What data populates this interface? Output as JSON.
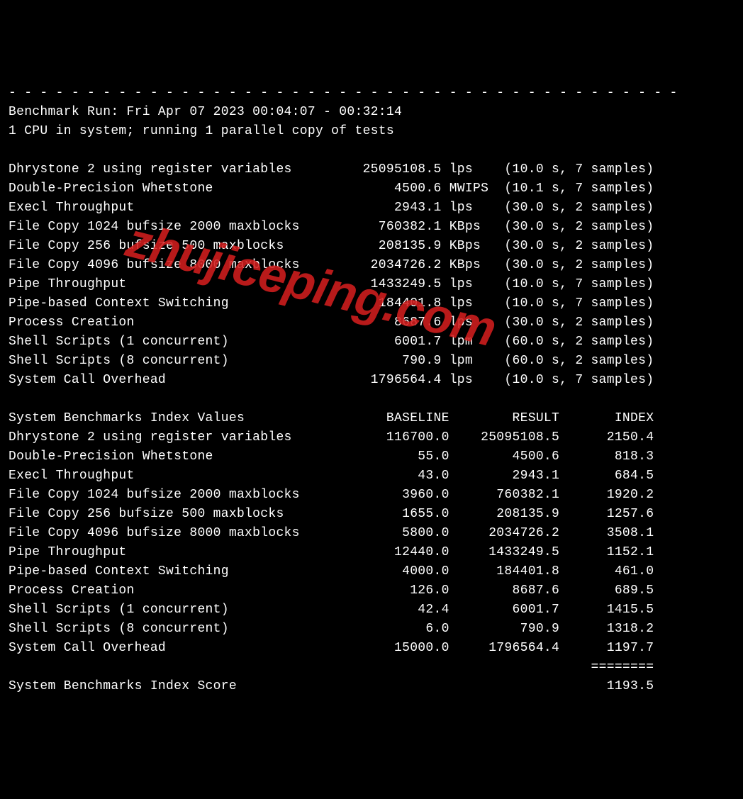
{
  "divider": "- - - - - - - - - - - - - - - - - - - - - - - - - - - - - - - - - - - - - - - - - - -",
  "header": {
    "run_line": "Benchmark Run: Fri Apr 07 2023 00:04:07 - 00:32:14",
    "cpu_line": "1 CPU in system; running 1 parallel copy of tests"
  },
  "tests": [
    {
      "name": "Dhrystone 2 using register variables",
      "value": "25095108.5",
      "unit": "lps",
      "dur": "10.0",
      "samples": "7"
    },
    {
      "name": "Double-Precision Whetstone",
      "value": "4500.6",
      "unit": "MWIPS",
      "dur": "10.1",
      "samples": "7"
    },
    {
      "name": "Execl Throughput",
      "value": "2943.1",
      "unit": "lps",
      "dur": "30.0",
      "samples": "2"
    },
    {
      "name": "File Copy 1024 bufsize 2000 maxblocks",
      "value": "760382.1",
      "unit": "KBps",
      "dur": "30.0",
      "samples": "2"
    },
    {
      "name": "File Copy 256 bufsize 500 maxblocks",
      "value": "208135.9",
      "unit": "KBps",
      "dur": "30.0",
      "samples": "2"
    },
    {
      "name": "File Copy 4096 bufsize 8000 maxblocks",
      "value": "2034726.2",
      "unit": "KBps",
      "dur": "30.0",
      "samples": "2"
    },
    {
      "name": "Pipe Throughput",
      "value": "1433249.5",
      "unit": "lps",
      "dur": "10.0",
      "samples": "7"
    },
    {
      "name": "Pipe-based Context Switching",
      "value": "184401.8",
      "unit": "lps",
      "dur": "10.0",
      "samples": "7"
    },
    {
      "name": "Process Creation",
      "value": "8687.6",
      "unit": "lps",
      "dur": "30.0",
      "samples": "2"
    },
    {
      "name": "Shell Scripts (1 concurrent)",
      "value": "6001.7",
      "unit": "lpm",
      "dur": "60.0",
      "samples": "2"
    },
    {
      "name": "Shell Scripts (8 concurrent)",
      "value": "790.9",
      "unit": "lpm",
      "dur": "60.0",
      "samples": "2"
    },
    {
      "name": "System Call Overhead",
      "value": "1796564.4",
      "unit": "lps",
      "dur": "10.0",
      "samples": "7"
    }
  ],
  "index_header": {
    "title": "System Benchmarks Index Values",
    "c1": "BASELINE",
    "c2": "RESULT",
    "c3": "INDEX"
  },
  "index": [
    {
      "name": "Dhrystone 2 using register variables",
      "baseline": "116700.0",
      "result": "25095108.5",
      "index": "2150.4"
    },
    {
      "name": "Double-Precision Whetstone",
      "baseline": "55.0",
      "result": "4500.6",
      "index": "818.3"
    },
    {
      "name": "Execl Throughput",
      "baseline": "43.0",
      "result": "2943.1",
      "index": "684.5"
    },
    {
      "name": "File Copy 1024 bufsize 2000 maxblocks",
      "baseline": "3960.0",
      "result": "760382.1",
      "index": "1920.2"
    },
    {
      "name": "File Copy 256 bufsize 500 maxblocks",
      "baseline": "1655.0",
      "result": "208135.9",
      "index": "1257.6"
    },
    {
      "name": "File Copy 4096 bufsize 8000 maxblocks",
      "baseline": "5800.0",
      "result": "2034726.2",
      "index": "3508.1"
    },
    {
      "name": "Pipe Throughput",
      "baseline": "12440.0",
      "result": "1433249.5",
      "index": "1152.1"
    },
    {
      "name": "Pipe-based Context Switching",
      "baseline": "4000.0",
      "result": "184401.8",
      "index": "461.0"
    },
    {
      "name": "Process Creation",
      "baseline": "126.0",
      "result": "8687.6",
      "index": "689.5"
    },
    {
      "name": "Shell Scripts (1 concurrent)",
      "baseline": "42.4",
      "result": "6001.7",
      "index": "1415.5"
    },
    {
      "name": "Shell Scripts (8 concurrent)",
      "baseline": "6.0",
      "result": "790.9",
      "index": "1318.2"
    },
    {
      "name": "System Call Overhead",
      "baseline": "15000.0",
      "result": "1796564.4",
      "index": "1197.7"
    }
  ],
  "index_divider": "                                                                          ========",
  "score_line": {
    "label": "System Benchmarks Index Score",
    "value": "1193.5"
  },
  "watermark": "zhujiceping.com"
}
